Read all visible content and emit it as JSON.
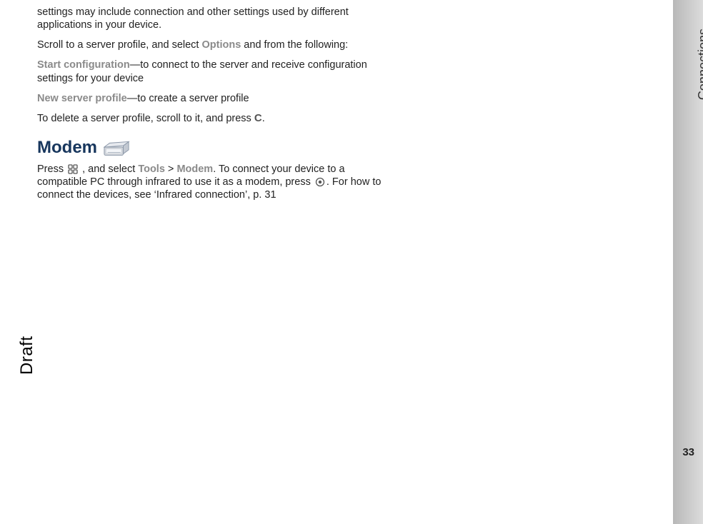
{
  "paragraphs": {
    "p1": "settings may include connection and other settings used by different applications in your device.",
    "p2a": "Scroll to a server profile, and select ",
    "p2_opt": "Options",
    "p2b": " and from the following:",
    "p3_label": "Start configuration",
    "p3_text": "—to connect to the server and receive configuration settings for your device",
    "p4_label": "New server profile",
    "p4_text": "—to create a server profile",
    "p5a": "To delete a server profile, scroll to it, and press ",
    "p5b": "."
  },
  "heading": "Modem",
  "modem": {
    "a1": "Press ",
    "a2": " , and select ",
    "tools": "Tools",
    "gt": " > ",
    "modem_link": "Modem",
    "a3": ". To connect your device to a compatible PC through infrared to use it as a modem, press ",
    "a4": ". For how to connect the devices, see ‘Infrared connection’, p. 31"
  },
  "sidebar": {
    "section": "Connections",
    "page": "33"
  },
  "watermark": "Draft",
  "icons": {
    "c_key": "C"
  }
}
